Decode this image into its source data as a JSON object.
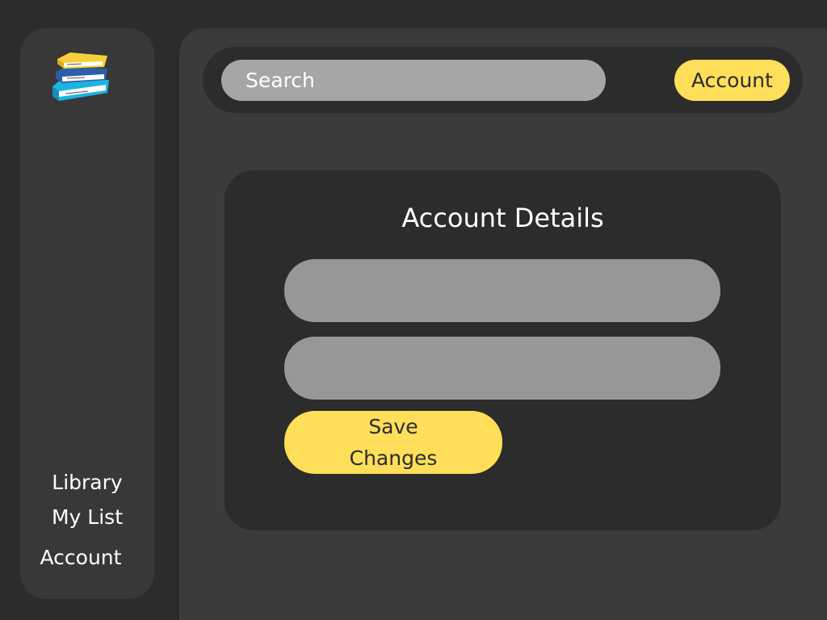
{
  "sidebar": {
    "logo_icon": "stacked-books-icon",
    "items": [
      {
        "label": "Library"
      },
      {
        "label": "My List"
      },
      {
        "label": "Account"
      }
    ]
  },
  "header": {
    "search": {
      "placeholder": "Search",
      "value": ""
    },
    "account_button": "Account"
  },
  "card": {
    "title": "Account Details",
    "fields": [
      {
        "value": ""
      },
      {
        "value": ""
      }
    ],
    "save_button": {
      "line1": "Save",
      "line2": "Changes"
    }
  },
  "colors": {
    "background": "#2c2c2c",
    "panel": "#3b3b3b",
    "sidebar": "#383838",
    "accent": "#ffde59",
    "input": "#a6a6a6",
    "field": "#979797",
    "text": "#ffffff"
  }
}
